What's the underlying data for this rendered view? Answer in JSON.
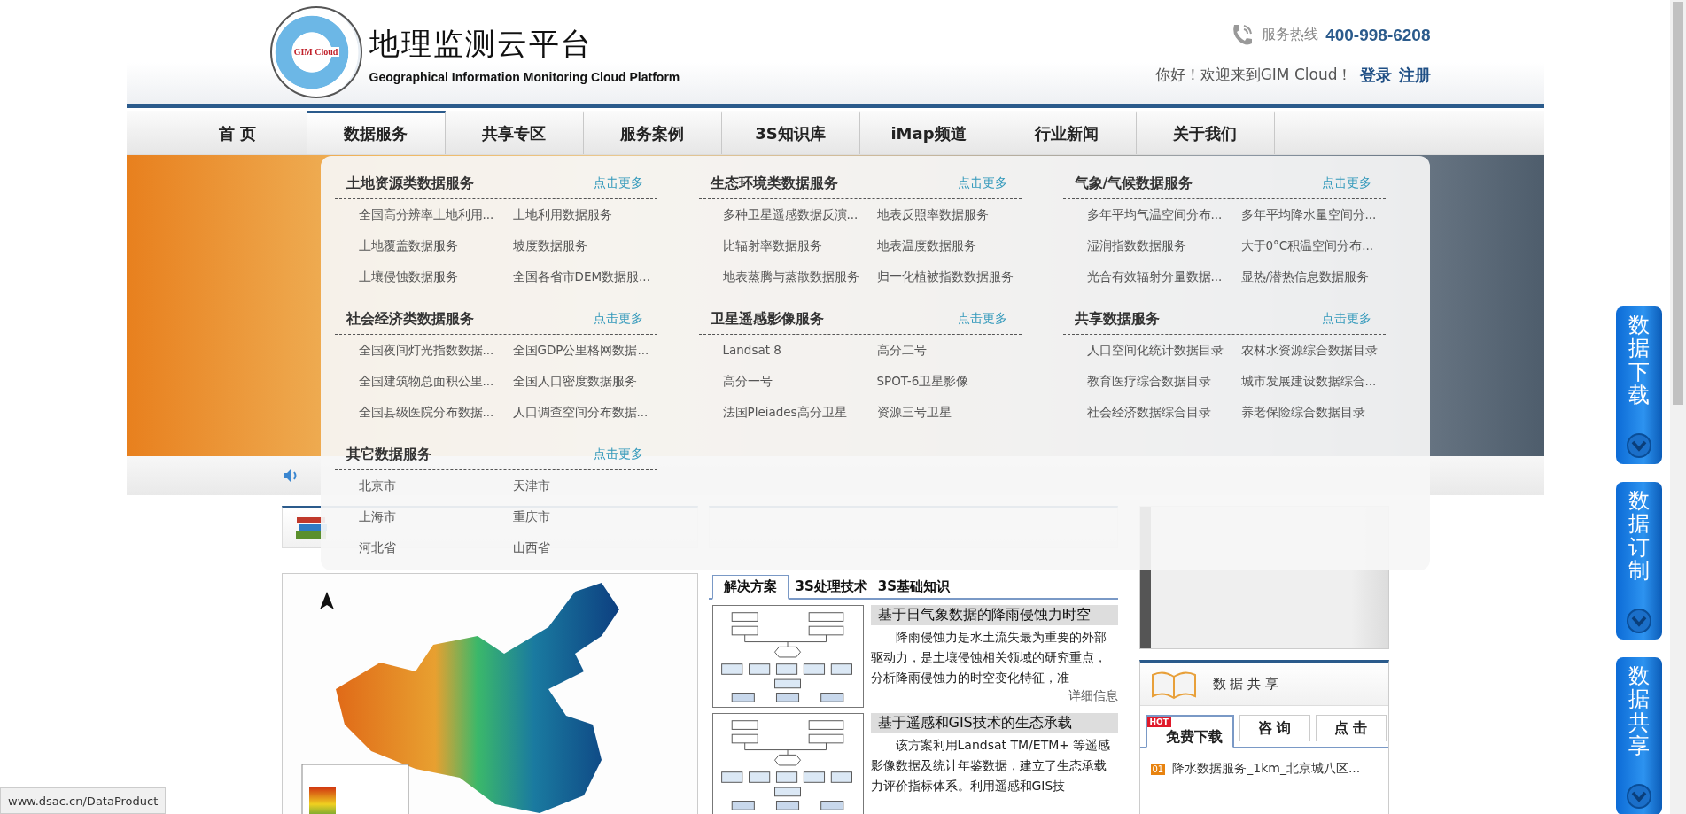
{
  "header": {
    "logo_text": "GIM Cloud",
    "title": "地理监测云平台",
    "subtitle": "Geographical Information Monitoring Cloud Platform",
    "hotline_label": "服务热线",
    "hotline_number": "400-998-6208",
    "greeting": "你好！欢迎来到GIM Cloud！",
    "login": "登录",
    "register": "注册"
  },
  "nav": [
    {
      "label": "首 页",
      "selected": false
    },
    {
      "label": "数据服务",
      "selected": true
    },
    {
      "label": "共享专区",
      "selected": false
    },
    {
      "label": "服务案例",
      "selected": false
    },
    {
      "label": "3S知识库",
      "selected": false
    },
    {
      "label": "iMap频道",
      "selected": false
    },
    {
      "label": "行业新闻",
      "selected": false
    },
    {
      "label": "关于我们",
      "selected": false
    }
  ],
  "dropdown": {
    "groups": [
      {
        "title": "土地资源类数据服务",
        "more": "点击更多",
        "items": [
          "全国高分辨率土地利用...",
          "土地利用数据服务",
          "土地覆盖数据服务",
          "坡度数据服务",
          "土壤侵蚀数据服务",
          "全国各省市DEM数据服..."
        ]
      },
      {
        "title": "生态环境类数据服务",
        "more": "点击更多",
        "items": [
          "多种卫星遥感数据反演...",
          "地表反照率数据服务",
          "比辐射率数据服务",
          "地表温度数据服务",
          "地表蒸腾与蒸散数据服务",
          "归一化植被指数数据服务"
        ]
      },
      {
        "title": "气象/气候数据服务",
        "more": "点击更多",
        "items": [
          "多年平均气温空间分布...",
          "多年平均降水量空间分...",
          "湿润指数数据服务",
          "大于0°C积温空间分布...",
          "光合有效辐射分量数据...",
          "显热/潜热信息数据服务"
        ]
      },
      {
        "title": "社会经济类数据服务",
        "more": "点击更多",
        "items": [
          "全国夜间灯光指数数据...",
          "全国GDP公里格网数据...",
          "全国建筑物总面积公里...",
          "全国人口密度数据服务",
          "全国县级医院分布数据...",
          "人口调查空间分布数据..."
        ]
      },
      {
        "title": "卫星遥感影像服务",
        "more": "点击更多",
        "items": [
          "Landsat 8",
          "高分二号",
          "高分一号",
          "SPOT-6卫星影像",
          "法国Pleiades高分卫星",
          "资源三号卫星"
        ]
      },
      {
        "title": "共享数据服务",
        "more": "点击更多",
        "items": [
          "人口空间化统计数据目录",
          "农林水资源综合数据目录",
          "教育医疗综合数据目录",
          "城市发展建设数据综合...",
          "社会经济数据综合目录",
          "养老保险综合数据目录"
        ]
      },
      {
        "title": "其它数据服务",
        "more": "点击更多",
        "items": [
          "北京市",
          "天津市",
          "上海市",
          "重庆市",
          "河北省",
          "山西省"
        ]
      }
    ]
  },
  "knowledge": {
    "tabs": [
      {
        "label": "解决方案",
        "selected": true
      },
      {
        "label": "3S处理技术",
        "selected": false
      },
      {
        "label": "3S基础知识",
        "selected": false
      }
    ],
    "articles": [
      {
        "title": "基于日气象数据的降雨侵蚀力时空",
        "body": "降雨侵蚀力是水土流失最为重要的外部驱动力，是土壤侵蚀相关领域的研究重点，分析降雨侵蚀力的时空变化特征，准",
        "more": "详细信息"
      },
      {
        "title": "基于遥感和GIS技术的生态承载",
        "body": "该方案利用Landsat TM/ETM+ 等遥感影像数据及统计年鉴数据，建立了生态承载力评价指标体系。利用遥感和GIS技"
      }
    ]
  },
  "share": {
    "title": "数 据 共 享",
    "tabs": [
      {
        "label": "免费下载",
        "badge": "HOT",
        "selected": true
      },
      {
        "label": "咨 询",
        "selected": false
      },
      {
        "label": "点 击",
        "selected": false
      }
    ],
    "items": [
      {
        "rank": "01",
        "text": "降水数据服务_1km_北京城八区..."
      }
    ]
  },
  "side_buttons": [
    {
      "label": "数据下载"
    },
    {
      "label": "数据订制"
    },
    {
      "label": "数据共享"
    }
  ],
  "status_url": "www.dsac.cn/DataProduct"
}
